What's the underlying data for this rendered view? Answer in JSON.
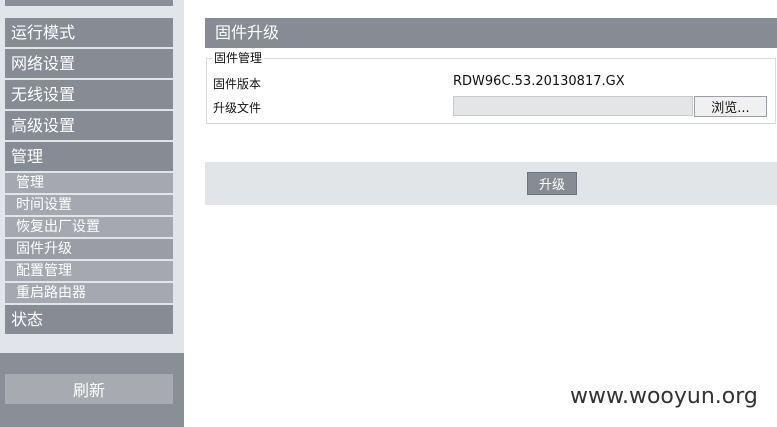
{
  "sidebar": {
    "menu": [
      {
        "label": "运行模式",
        "type": "main"
      },
      {
        "label": "网络设置",
        "type": "main"
      },
      {
        "label": "无线设置",
        "type": "main"
      },
      {
        "label": "高级设置",
        "type": "main"
      },
      {
        "label": "管理",
        "type": "main"
      },
      {
        "label": "管理",
        "type": "sub"
      },
      {
        "label": "时间设置",
        "type": "sub"
      },
      {
        "label": "恢复出厂设置",
        "type": "sub"
      },
      {
        "label": "固件升级",
        "type": "sub",
        "active": true
      },
      {
        "label": "配置管理",
        "type": "sub"
      },
      {
        "label": "重启路由器",
        "type": "sub"
      },
      {
        "label": "状态",
        "type": "main"
      }
    ],
    "refresh_label": "刷新"
  },
  "main": {
    "title": "固件升级",
    "section_legend": "固件管理",
    "firmware_version_label": "固件版本",
    "firmware_version_value": "RDW96C.53.20130817.GX",
    "upgrade_file_label": "升级文件",
    "upgrade_file_value": "",
    "browse_label": "浏览...",
    "upgrade_button_label": "升级"
  },
  "watermark": "www.wooyun.org",
  "colors": {
    "menu_main": "#878b93",
    "menu_sub": "#a5a8ae",
    "sidebar_bg": "#e1e5e9",
    "action_bar": "#e2e5e8"
  }
}
